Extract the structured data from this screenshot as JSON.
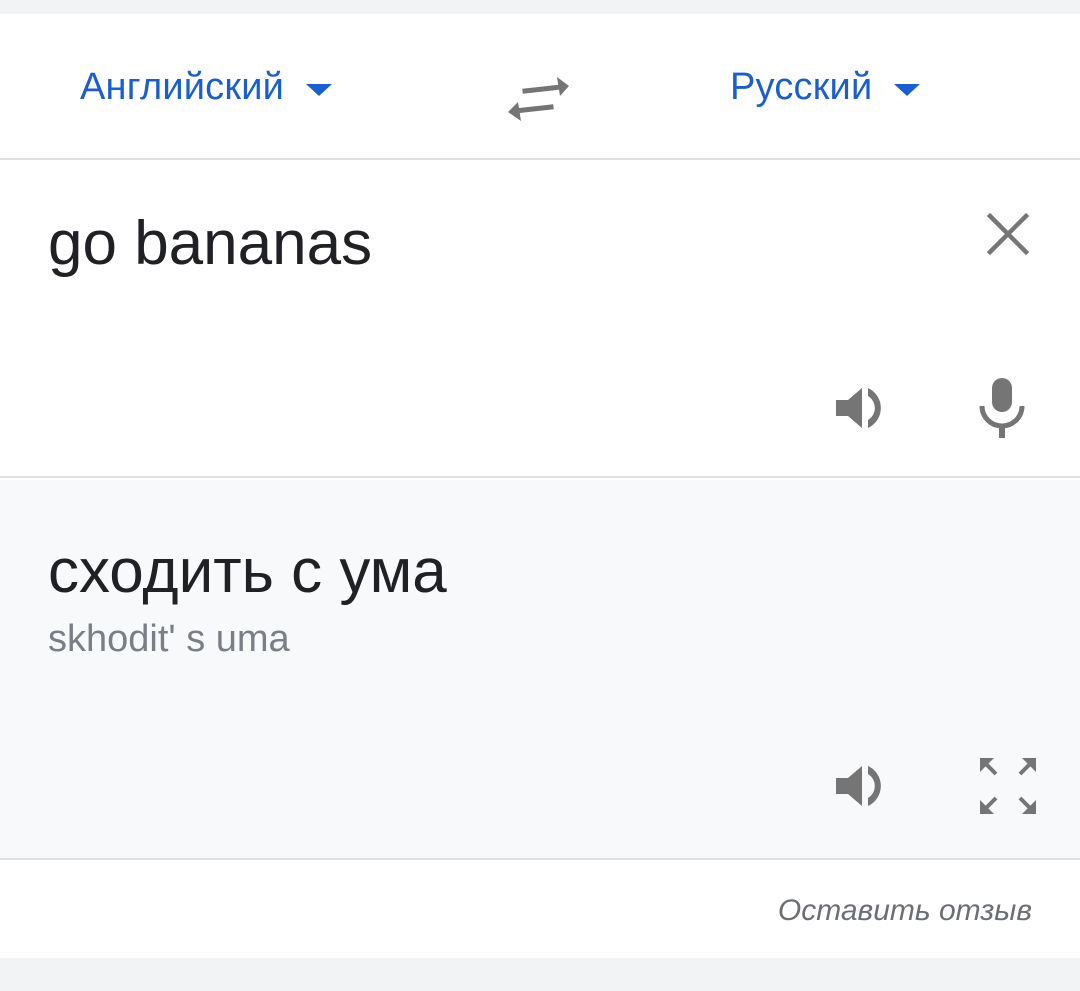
{
  "languages": {
    "source": "Английский",
    "target": "Русский"
  },
  "input": {
    "text": "go bananas"
  },
  "translation": {
    "text": "сходить с ума",
    "transliteration": "skhodit' s uma"
  },
  "footer": {
    "feedback_label": "Оставить отзыв"
  },
  "icons": {
    "swap": "swap-arrows-icon",
    "clear": "close-icon",
    "listen": "speaker-icon",
    "mic": "microphone-icon",
    "fullscreen": "fullscreen-icon",
    "dropdown": "caret-down-icon"
  },
  "colors": {
    "accent": "#1a5fd1",
    "icon": "#757575",
    "text": "#202124",
    "muted": "#7a7f85"
  }
}
